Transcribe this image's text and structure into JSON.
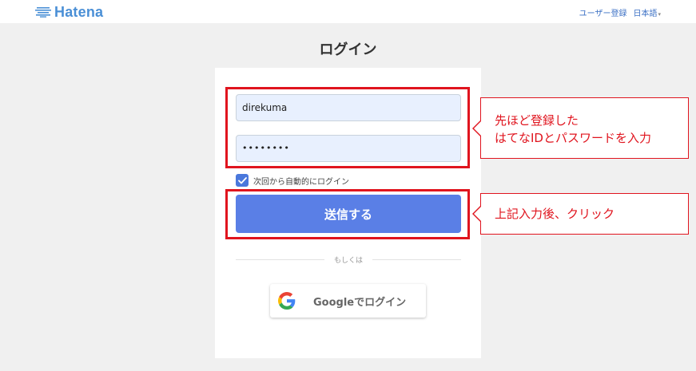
{
  "header": {
    "logo_text": "Hatena",
    "register_link": "ユーザー登録",
    "language_select": "日本語"
  },
  "page": {
    "title": "ログイン"
  },
  "form": {
    "username_value": "direkuma",
    "password_value": "••••••••",
    "remember_checked": true,
    "remember_label": "次回から自動的にログイン",
    "submit_label": "送信する",
    "divider_text": "もしくは",
    "google_label": "Googleでログイン"
  },
  "annotations": {
    "callout_credentials": [
      "先ほど登録した",
      "はてなIDとパスワードを入力"
    ],
    "callout_submit": "上記入力後、クリック"
  },
  "colors": {
    "highlight": "#e0141e",
    "primary_button": "#5a7fe6",
    "brand": "#4a8fd6",
    "input_bg": "#e8f0fe"
  }
}
